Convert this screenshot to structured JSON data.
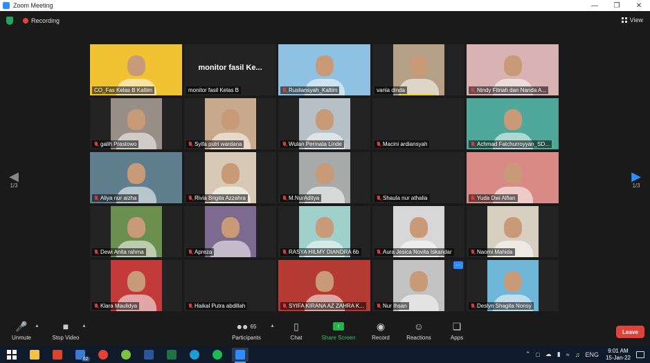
{
  "window": {
    "title": "Zoom Meeting",
    "controls": [
      "minimize",
      "maximize",
      "close"
    ]
  },
  "topbar": {
    "recording_label": "Recording",
    "view_label": "View"
  },
  "pager": {
    "left_page": "1/3",
    "right_page": "1/3"
  },
  "participants": [
    {
      "name": "CO_Fas Kelas B Kaltim",
      "video": true,
      "muted": false,
      "active": true,
      "bg": "#f1c232"
    },
    {
      "name": "monitor fasil Kelas B",
      "video": false,
      "muted": false,
      "bigname": "monitor fasil Ke..."
    },
    {
      "name": "Rusliansyah_Kaltim",
      "video": true,
      "muted": true,
      "bg": "#8fc1e3"
    },
    {
      "name": "vania dinda",
      "video": true,
      "muted": false,
      "bg": "#b59f86",
      "narrow": true
    },
    {
      "name": "Nindy Fitriah dan Nanda A...",
      "video": true,
      "muted": true,
      "bg": "#d9b2b4"
    },
    {
      "name": "galih Prastowo",
      "video": true,
      "muted": true,
      "bg": "#9a8f86",
      "narrow": true
    },
    {
      "name": "Syifa putri wardana",
      "video": true,
      "muted": true,
      "bg": "#c9a98b",
      "narrow": true
    },
    {
      "name": "Wulan Permata Linde",
      "video": true,
      "muted": true,
      "bg": "#b6c1c7",
      "narrow": true
    },
    {
      "name": "Macini ardiansyah",
      "video": false,
      "muted": true
    },
    {
      "name": "Achmad Fatchurroyyan_SD...",
      "video": true,
      "muted": true,
      "bg": "#4fa89a"
    },
    {
      "name": "Aliya nur aizha",
      "video": true,
      "muted": true,
      "bg": "#5f7f8f"
    },
    {
      "name": "Rivia Brigita Azzahra",
      "video": true,
      "muted": true,
      "bg": "#d7c9b6",
      "narrow": true
    },
    {
      "name": "M.NurAditya",
      "video": true,
      "muted": true,
      "bg": "#a7aaa9",
      "narrow": true
    },
    {
      "name": "Shaula nur athalia",
      "video": false,
      "muted": true
    },
    {
      "name": "Yuda Dwi Alfian",
      "video": true,
      "muted": true,
      "bg": "#d98a86"
    },
    {
      "name": "Dewi Anita rahma",
      "video": true,
      "muted": true,
      "bg": "#6a8f4f",
      "narrow": true
    },
    {
      "name": "Apreza",
      "video": true,
      "muted": true,
      "bg": "#7d6a8f",
      "narrow": true
    },
    {
      "name": "RASYA HILMY DIANDRA 6b",
      "video": true,
      "muted": true,
      "bg": "#9fd0cc",
      "narrow": true
    },
    {
      "name": "Aura Jesica Novita Iskandar",
      "video": true,
      "muted": true,
      "bg": "#d7d7d7",
      "narrow": true
    },
    {
      "name": "Naomi Mahida",
      "video": true,
      "muted": true,
      "bg": "#d8cfc1",
      "narrow": true
    },
    {
      "name": "Klara Maulidya",
      "video": true,
      "muted": true,
      "bg": "#c23a3a",
      "narrow": true
    },
    {
      "name": "Haikal Putra abdillah",
      "video": false,
      "muted": true
    },
    {
      "name": "SYIFA KIRANA AZ ZAHRA K...",
      "video": true,
      "muted": true,
      "bg": "#b53a32"
    },
    {
      "name": "Nur Ihsan",
      "video": true,
      "muted": true,
      "bg": "#c2c2c2",
      "narrow": true,
      "more": "..."
    },
    {
      "name": "Deslyn Shagita Nonsy",
      "video": true,
      "muted": true,
      "bg": "#6fb7d9",
      "narrow": true
    }
  ],
  "toolbar": {
    "unmute": "Unmute",
    "stop_video": "Stop Video",
    "participants": "Participants",
    "participant_count": "65",
    "chat": "Chat",
    "share_screen": "Share Screen",
    "record": "Record",
    "reactions": "Reactions",
    "apps": "Apps",
    "leave": "Leave"
  },
  "taskbar": {
    "mail_badge": "62",
    "language": "ENG",
    "time": "9:01 AM",
    "date": "15-Jan-22"
  },
  "colors": {
    "accent": "#2d8cff",
    "leave": "#e0433a",
    "share": "#23b34a",
    "active_speaker": "#f3d23a"
  }
}
